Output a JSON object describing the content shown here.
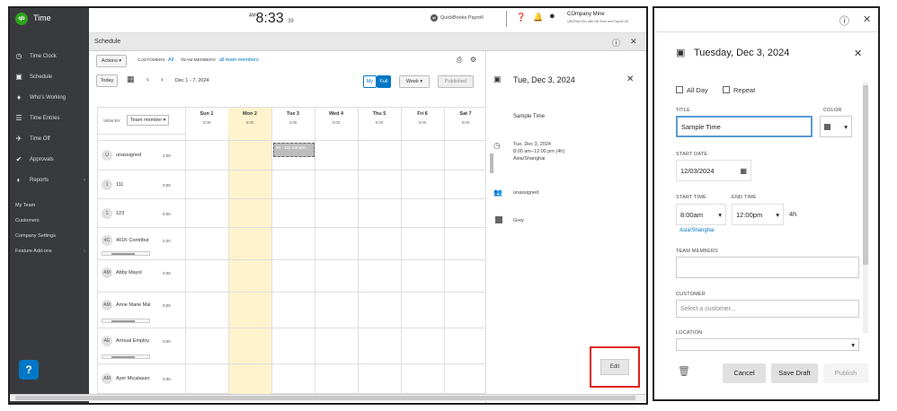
{
  "app": {
    "title": "Time",
    "logo": "qb"
  },
  "nav": {
    "items": [
      {
        "label": "Time Clock",
        "icon": "clock-icon"
      },
      {
        "label": "Schedule",
        "icon": "calendar-icon"
      },
      {
        "label": "Who's Working",
        "icon": "pin-icon"
      },
      {
        "label": "Time Entries",
        "icon": "entries-icon"
      },
      {
        "label": "Time Off",
        "icon": "plane-icon"
      },
      {
        "label": "Approvals",
        "icon": "check-icon"
      },
      {
        "label": "Reports",
        "icon": "pie-icon"
      }
    ],
    "plain": [
      "My Team",
      "Customers",
      "Company Settings",
      "Feature Add-ons"
    ]
  },
  "topbar": {
    "clock_ampm": "AM",
    "clock_time": "8:33",
    "clock_sec": "39",
    "payroll_label": "QuickBooks Payroll",
    "company_name": "COmpany Mine",
    "company_sub": "QBOTest Plus with QB Time and Payroll US"
  },
  "schedule": {
    "header_title": "Schedule",
    "actions_label": "Actions",
    "customers_label": "CUSTOMERS",
    "customers_value": "All",
    "team_label": "TEAM MEMBERS",
    "team_value": "all team members",
    "today_label": "Today",
    "date_range": "Dec 1 - 7, 2024",
    "my_label": "My",
    "full_label": "Full",
    "week_label": "Week",
    "published_label": "Published",
    "view_by_label": "VIEW BY",
    "view_by_value": "Team member",
    "days": [
      {
        "name": "Sun 1",
        "total": "0:00"
      },
      {
        "name": "Mon 2",
        "total": "0:00"
      },
      {
        "name": "Tue 3",
        "total": "4:00"
      },
      {
        "name": "Wed 4",
        "total": "0:00"
      },
      {
        "name": "Thu 5",
        "total": "0:00"
      },
      {
        "name": "Fri 6",
        "total": "0:00"
      },
      {
        "name": "Sat 7",
        "total": "0:00"
      }
    ],
    "shift_label": "8a - 12p Sample...",
    "rows": [
      {
        "initials": "U",
        "name": "unassigned",
        "hours": "4:00"
      },
      {
        "initials": "1",
        "name": "111",
        "hours": "0:00"
      },
      {
        "initials": "1",
        "name": "123",
        "hours": "0:00"
      },
      {
        "initials": "4C",
        "name": "401K Contribut",
        "hours": "0:00"
      },
      {
        "initials": "AM",
        "name": "Abby Mayol",
        "hours": "0:00"
      },
      {
        "initials": "AM",
        "name": "Anne Marie Mal",
        "hours": "0:00"
      },
      {
        "initials": "AE",
        "name": "Annual Employ",
        "hours": "0:00"
      },
      {
        "initials": "AM",
        "name": "Ayer Micalasan",
        "hours": "0:00"
      }
    ]
  },
  "detail": {
    "date": "Tue, Dec 3, 2024",
    "title": "Sample Time",
    "when_line1": "Tue, Dec 3, 2024",
    "when_line2": "8:00 am–12:00 pm (4h)",
    "when_line3": "Asia/Shanghai",
    "assignee": "unassigned",
    "color": "Grey",
    "edit_label": "Edit"
  },
  "editor": {
    "date": "Tuesday, Dec 3, 2024",
    "all_day_label": "All Day",
    "repeat_label": "Repeat",
    "title_label": "TITLE",
    "title_value": "Sample Time",
    "color_label": "COLOR",
    "start_date_label": "START DATE",
    "start_date_value": "12/03/2024",
    "start_time_label": "START TIME",
    "start_time_value": "8:00am",
    "end_time_label": "END TIME",
    "end_time_value": "12:00pm",
    "duration": "4h",
    "timezone": "Asia/Shanghai",
    "team_members_label": "TEAM MEMBERS",
    "customer_label": "CUSTOMER",
    "customer_placeholder": "Select a customer...",
    "location_label": "LOCATION",
    "cancel_label": "Cancel",
    "save_draft_label": "Save Draft",
    "publish_label": "Publish"
  },
  "colors": {
    "nav_bg": "#393a3d",
    "qb_green": "#2ca01c",
    "accent_blue": "#0077c5",
    "today_yellow": "#fff3cd",
    "highlight_red": "#e2231a"
  }
}
